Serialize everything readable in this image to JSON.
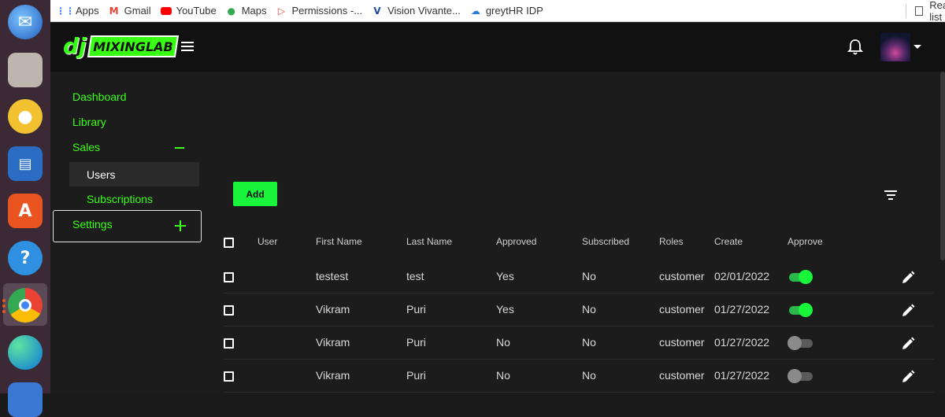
{
  "bookmarks": [
    {
      "label": "Apps",
      "icon": "apps-grid-icon",
      "color": "#4285f4"
    },
    {
      "label": "Gmail",
      "icon": "gmail-icon",
      "color": "#ea4335"
    },
    {
      "label": "YouTube",
      "icon": "youtube-icon",
      "color": "#ff0000"
    },
    {
      "label": "Maps",
      "icon": "maps-pin-icon",
      "color": "#34a853"
    },
    {
      "label": "Permissions -...",
      "icon": "permissions-icon",
      "color": "#e74c3c"
    },
    {
      "label": "Vision Vivante...",
      "icon": "vision-vivante-icon",
      "color": "#1a4ba0"
    },
    {
      "label": "greytHR IDP",
      "icon": "greythr-icon",
      "color": "#2a7bd5"
    }
  ],
  "reading_list": "Reading list",
  "sidebar": {
    "dashboard": "Dashboard",
    "library": "Library",
    "sales": "Sales",
    "users": "Users",
    "subscriptions": "Subscriptions",
    "settings": "Settings"
  },
  "main": {
    "add_label": "Add"
  },
  "table": {
    "headers": {
      "user": "User",
      "first_name": "First Name",
      "last_name": "Last Name",
      "approved": "Approved",
      "subscribed": "Subscribed",
      "roles": "Roles",
      "create": "Create",
      "approve": "Approve"
    },
    "rows": [
      {
        "first_name": "testest",
        "last_name": "test",
        "approved": "Yes",
        "subscribed": "No",
        "role": "customer",
        "created": "02/01/2022",
        "approve_on": true
      },
      {
        "first_name": "Vikram",
        "last_name": "Puri",
        "approved": "Yes",
        "subscribed": "No",
        "role": "customer",
        "created": "01/27/2022",
        "approve_on": true
      },
      {
        "first_name": "Vikram",
        "last_name": "Puri",
        "approved": "No",
        "subscribed": "No",
        "role": "customer",
        "created": "01/27/2022",
        "approve_on": false
      },
      {
        "first_name": "Vikram",
        "last_name": "Puri",
        "approved": "No",
        "subscribed": "No",
        "role": "customer",
        "created": "01/27/2022",
        "approve_on": false
      }
    ]
  },
  "colors": {
    "accent": "#39ff14",
    "button": "#18f53a",
    "background": "#1c1c1c",
    "topbar": "#111111"
  }
}
